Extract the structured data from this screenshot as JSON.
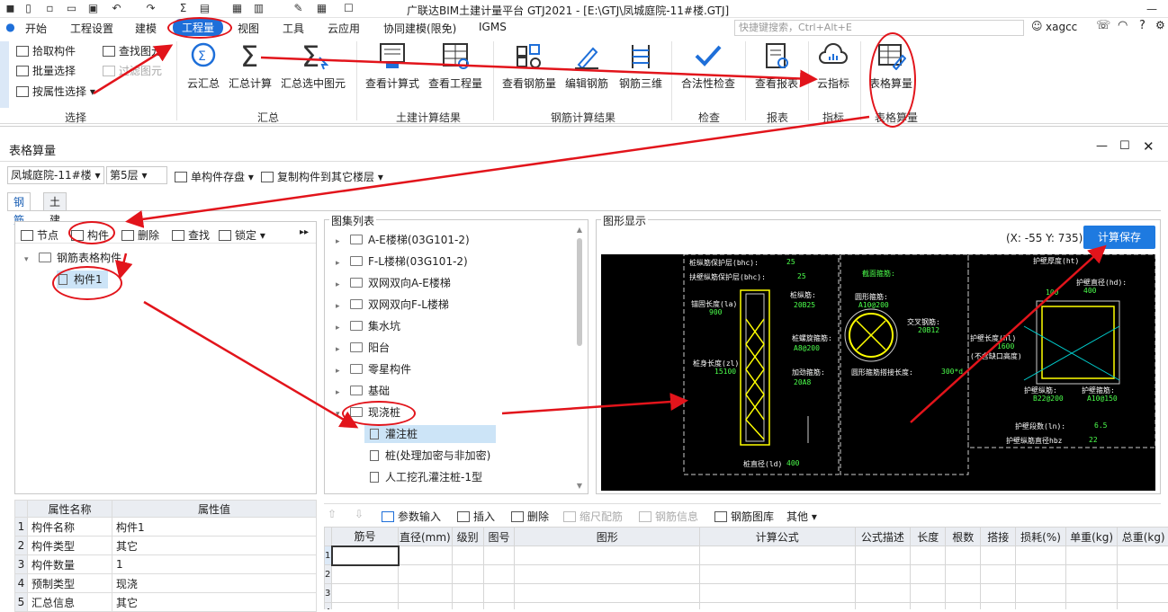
{
  "title": "广联达BIM土建计量平台 GTJ2021 - [E:\\GTJ\\凤城庭院-11#楼.GTJ]",
  "menu": [
    "开始",
    "工程设置",
    "建模",
    "工程量",
    "视图",
    "工具",
    "云应用",
    "协同建模(限免)",
    "IGMS"
  ],
  "search_placeholder": "快捷键搜索，Ctrl+Alt+E",
  "user": "xagcc",
  "ribbon": {
    "select_small": [
      "拾取构件",
      "批量选择",
      "按属性选择"
    ],
    "find_small": [
      "查找图元",
      "过滤图元"
    ],
    "big": [
      "云汇总",
      "汇总计算",
      "汇总选中图元",
      "查看计算式",
      "查看工程量",
      "查看钢筋量",
      "编辑钢筋",
      "钢筋三维",
      "合法性检查",
      "查看报表",
      "云指标",
      "表格算量"
    ],
    "groups": [
      "选择",
      "汇总",
      "土建计算结果",
      "钢筋计算结果",
      "检查",
      "报表",
      "指标",
      "表格算量"
    ]
  },
  "panel": {
    "title": "表格算量",
    "project": "凤城庭院-11#楼",
    "floor": "第5层",
    "save_btn": "单构件存盘",
    "copy_btn": "复制构件到其它楼层",
    "tabs": [
      "钢筋",
      "土建"
    ],
    "tree_toolbar": [
      "节点",
      "构件",
      "删除",
      "查找",
      "锁定"
    ],
    "tree": {
      "root": "钢筋表格构件",
      "child": "构件1"
    },
    "props_header": [
      "属性名称",
      "属性值"
    ],
    "props": [
      [
        "1",
        "构件名称",
        "构件1"
      ],
      [
        "2",
        "构件类型",
        "其它"
      ],
      [
        "3",
        "构件数量",
        "1"
      ],
      [
        "4",
        "预制类型",
        "现浇"
      ],
      [
        "5",
        "汇总信息",
        "其它"
      ]
    ],
    "atlas_title": "图集列表",
    "atlas": [
      "A-E楼梯(03G101-2)",
      "F-L楼梯(03G101-2)",
      "双网双向A-E楼梯",
      "双网双向F-L楼梯",
      "集水坑",
      "阳台",
      "零星构件",
      "基础",
      "现浇桩"
    ],
    "atlas_children": [
      "灌注桩",
      "桩(处理加密与非加密)",
      "人工挖孔灌注桩-1型"
    ],
    "graph_title": "图形显示",
    "coord": "(X: -55 Y: 735)",
    "calc_btn": "计算保存",
    "bottom_toolbar": [
      "参数输入",
      "插入",
      "删除",
      "缩尺配筋",
      "钢筋信息",
      "钢筋图库",
      "其他"
    ],
    "grid_headers": [
      "筋号",
      "直径(mm)",
      "级别",
      "图号",
      "图形",
      "计算公式",
      "公式描述",
      "长度",
      "根数",
      "搭接",
      "损耗(%)",
      "单重(kg)",
      "总重(kg)"
    ],
    "grid_rows": [
      "1",
      "2",
      "3",
      "4"
    ]
  },
  "cad": {
    "labels": [
      "桩纵筋保护层(bhc):",
      "扶壁纵筋保护层(bhc):",
      "锚固长度(la)",
      "桩纵筋:",
      "桩螺旋箍筋:",
      "桩身长度(zl)",
      "加劲箍筋:",
      "桩直径(ld)",
      "截面箍筋:",
      "圆形箍筋:",
      "交叉钢筋:",
      "圆形箍筋搭接长度:",
      "护壁厚度(ht)",
      "护壁直径(hd):",
      "护壁长度(hl)",
      "(不含缺口高度)",
      "护壁纵筋:",
      "护壁箍筋:",
      "护壁段数(ln):",
      "护壁纵筋直径hbz"
    ],
    "values": [
      "25",
      "25",
      "900",
      "20B25",
      "A8@200",
      "15100",
      "20A8",
      "400",
      "A10@200",
      "20B12",
      "300*d",
      "100",
      "400",
      "1600",
      "B22@200",
      "A10@150",
      "6.5",
      "22"
    ]
  }
}
